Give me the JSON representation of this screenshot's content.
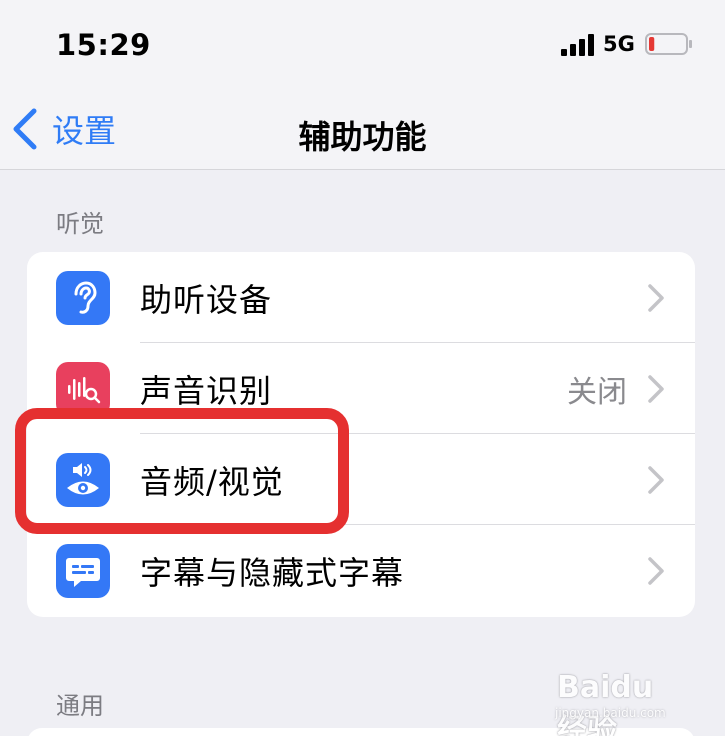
{
  "status_bar": {
    "time": "15:29",
    "network": "5G",
    "battery_level": 0.15,
    "battery_color": "#e53935"
  },
  "nav": {
    "back_label": "设置",
    "title": "辅助功能",
    "accent_color": "#2f7cf6"
  },
  "sections": [
    {
      "header": "听觉",
      "rows": [
        {
          "label": "助听设备",
          "value": "",
          "icon": "ear-icon",
          "icon_color": "#3478f6"
        },
        {
          "label": "声音识别",
          "value": "关闭",
          "icon": "sound-recognition-icon",
          "icon_color": "#e8405e"
        },
        {
          "label": "音频/视觉",
          "value": "",
          "icon": "audio-visual-icon",
          "icon_color": "#3478f6"
        },
        {
          "label": "字幕与隐藏式字幕",
          "value": "",
          "icon": "captions-icon",
          "icon_color": "#3478f6"
        }
      ]
    },
    {
      "header": "通用",
      "rows": []
    }
  ],
  "highlight_color": "#e53030",
  "watermark": {
    "brand": "Baidu 经验",
    "url": "jingyan.baidu.com"
  }
}
